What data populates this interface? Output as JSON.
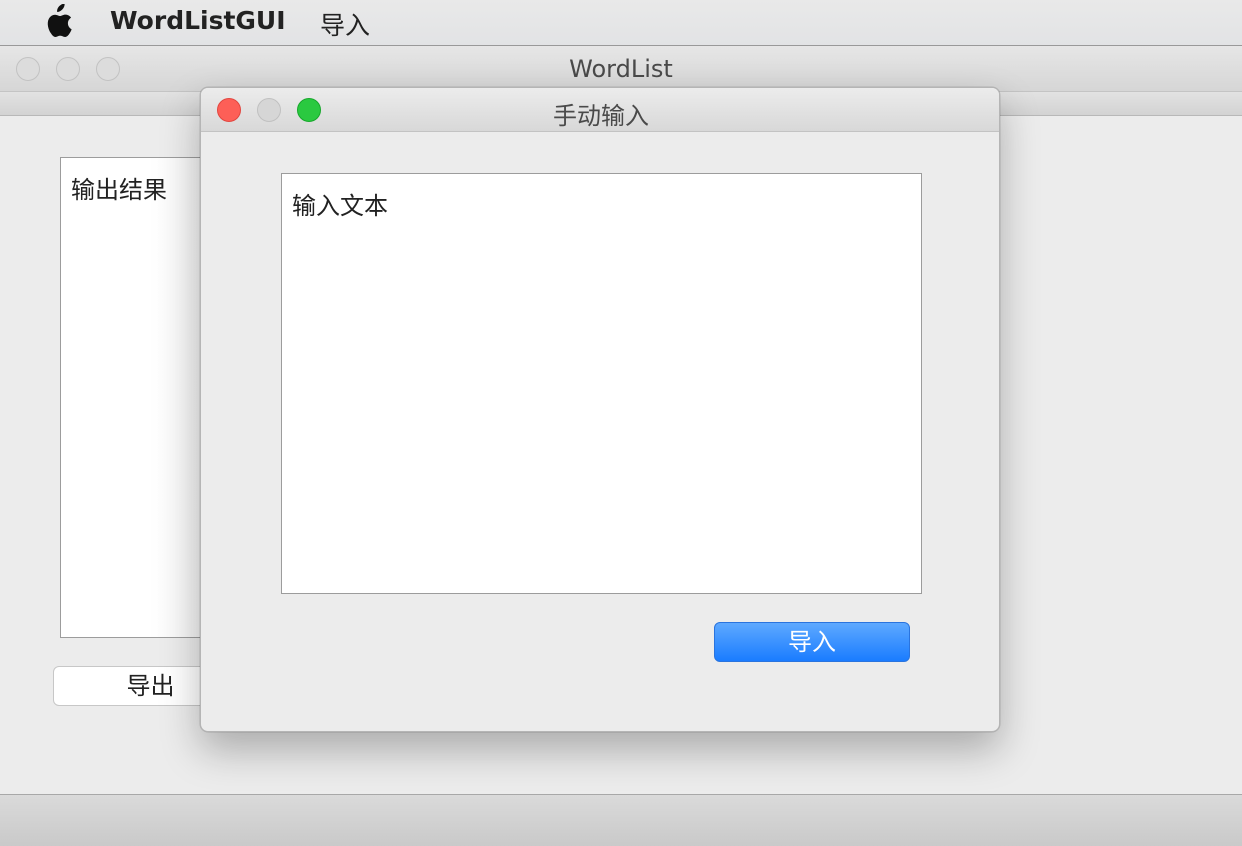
{
  "menubar": {
    "app_name": "WordListGUI",
    "menu_import": "导入",
    "logo": "apple-icon"
  },
  "main_window": {
    "title": "WordList",
    "output_text": "输出结果",
    "export_label": "导出"
  },
  "dialog": {
    "title": "手动输入",
    "input_text": "输入文本",
    "import_label": "导入"
  },
  "colors": {
    "accent": "#1a7cff",
    "close": "#fd5f57",
    "maximize": "#2ac940"
  }
}
